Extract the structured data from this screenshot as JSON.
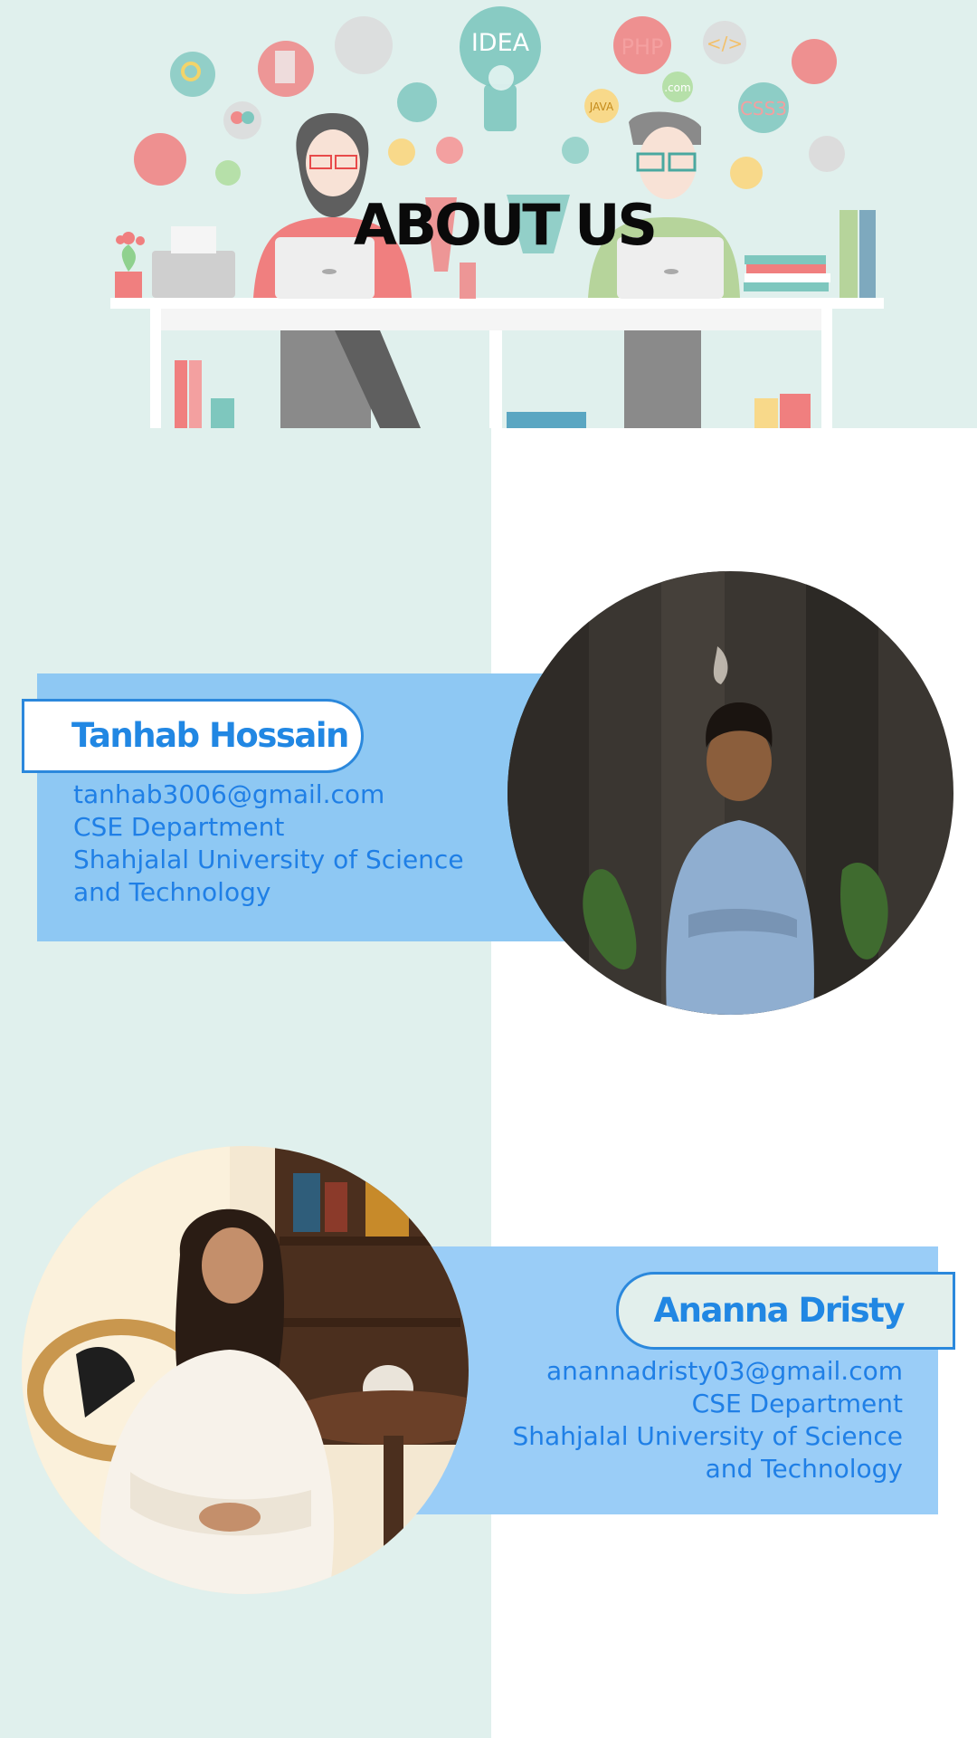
{
  "hero": {
    "title": "ABOUT US",
    "icons": {
      "idea": "IDEA",
      "php": "PHP",
      "java": "JAVA",
      "css": "CSS3",
      "com": ".com",
      "code": "</>",
      "sketch": "sketch"
    }
  },
  "members": [
    {
      "name": "Tanhab Hossain",
      "email": "tanhab3006@gmail.com",
      "department": "CSE Department",
      "university_line1": "Shahjalal University of Science",
      "university_line2": "and Technology"
    },
    {
      "name": "Ananna Dristy",
      "email": "anannadristy03@gmail.com",
      "department": "CSE Department",
      "university_line1": "Shahjalal University of Science",
      "university_line2": "and Technology"
    }
  ],
  "colors": {
    "panel": "#e0f0ed",
    "band1": "#8ec8f3",
    "band2": "#9acdf7",
    "accent": "#2187e3"
  }
}
